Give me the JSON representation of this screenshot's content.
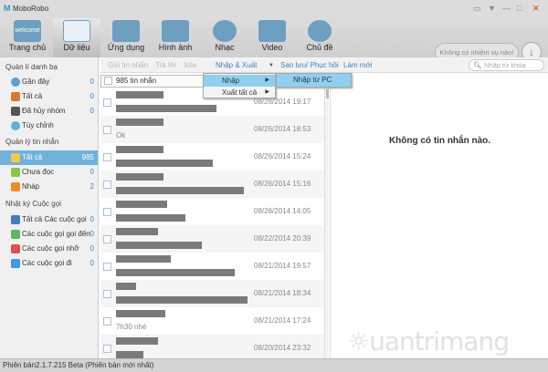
{
  "app": {
    "title": "MoboRobo"
  },
  "toolbar": {
    "items": [
      {
        "label": "Trang chủ",
        "icon": "welcome"
      },
      {
        "label": "Dữ liệu"
      },
      {
        "label": "Ứng dụng"
      },
      {
        "label": "Hình ảnh"
      },
      {
        "label": "Nhạc"
      },
      {
        "label": "Video"
      },
      {
        "label": "Chủ đề"
      }
    ],
    "task": "Không có nhiệm vụ nào!"
  },
  "actions": {
    "send": "Gửi tin nhắn",
    "reply": "Trả lời",
    "delete": "Xóa",
    "import_export": "Nhập & Xuất",
    "backup": "Sao lưu/ Phục hồi",
    "refresh": "Làm mới",
    "search_placeholder": "Nhập từ khóa"
  },
  "sidebar": {
    "contacts_title": "Quản lí danh bạ",
    "contacts": [
      {
        "label": "Gần đây",
        "count": "0"
      },
      {
        "label": "Tất cả",
        "count": "0"
      },
      {
        "label": "Đã hủy nhóm",
        "count": "0"
      },
      {
        "label": "Tùy chỉnh",
        "count": ""
      }
    ],
    "messages_title": "Quản lý tin nhắn",
    "messages": [
      {
        "label": "Tất cả",
        "count": "985"
      },
      {
        "label": "Chưa đọc",
        "count": "0"
      },
      {
        "label": "Nháp",
        "count": "2"
      }
    ],
    "calls_title": "Nhật ký Cuộc gọi",
    "calls": [
      {
        "label": "Tất cả Các cuộc gọi",
        "count": "0"
      },
      {
        "label": "Các cuộc gọi gọi đến",
        "count": "0"
      },
      {
        "label": "Các cuộc gọi nhỡ",
        "count": "0"
      },
      {
        "label": "Các cuộc gọi đi",
        "count": "0"
      }
    ]
  },
  "list": {
    "header": "985 tin nhắn",
    "rows": [
      {
        "preview": "",
        "date": "08/26/2014  19:17"
      },
      {
        "preview": "Ok",
        "date": "08/26/2014  18:53"
      },
      {
        "preview": "",
        "date": "08/26/2014  15:24"
      },
      {
        "preview": "",
        "date": "08/26/2014  15:16"
      },
      {
        "preview": "",
        "date": "08/26/2014  14:05"
      },
      {
        "preview": "",
        "date": "08/22/2014  20:39"
      },
      {
        "preview": "",
        "date": "08/21/2014  19:57"
      },
      {
        "preview": "",
        "date": "08/21/2014  18:34"
      },
      {
        "preview": "7h30 nhé",
        "date": "08/21/2014  17:24"
      },
      {
        "preview": "",
        "date": "08/20/2014  23:32"
      }
    ]
  },
  "menu": {
    "import": "Nhập",
    "export_all": "Xuất tất cả",
    "import_from_pc": "Nhập từ PC"
  },
  "detail": {
    "empty": "Không có tin nhắn nào."
  },
  "status": {
    "version": "Phiên bản2.1.7.215 Beta  (Phiên bản mới nhất)"
  },
  "watermark": "Quantrimang"
}
